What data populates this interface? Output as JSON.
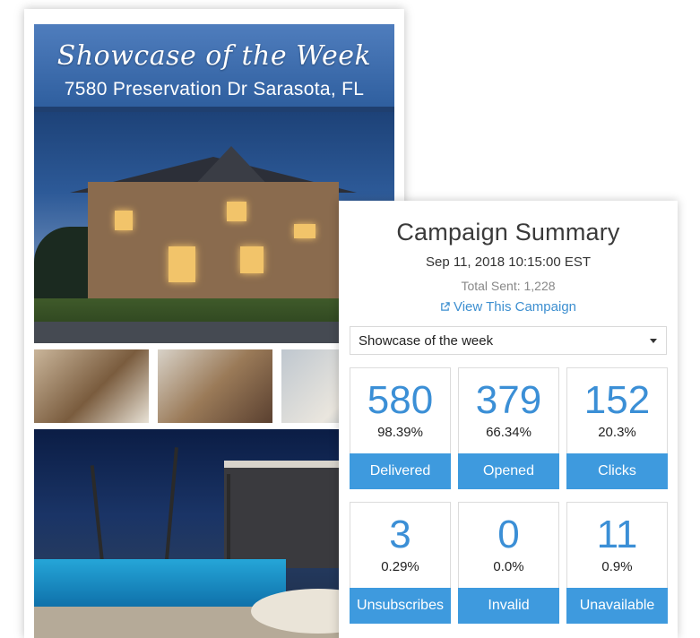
{
  "email": {
    "banner_title": "Showcase of the Week",
    "banner_address": "7580 Preservation Dr Sarasota, FL"
  },
  "summary": {
    "title": "Campaign Summary",
    "date": "Sep 11, 2018 10:15:00 EST",
    "total_sent": "Total Sent: 1,228",
    "view_link": "View This Campaign",
    "selected_campaign": "Showcase of the week"
  },
  "stats": [
    {
      "value": "580",
      "percent": "98.39%",
      "label": "Delivered"
    },
    {
      "value": "379",
      "percent": "66.34%",
      "label": "Opened"
    },
    {
      "value": "152",
      "percent": "20.3%",
      "label": "Clicks"
    },
    {
      "value": "3",
      "percent": "0.29%",
      "label": "Unsubscribes"
    },
    {
      "value": "0",
      "percent": "0.0%",
      "label": "Invalid"
    },
    {
      "value": "11",
      "percent": "0.9%",
      "label": "Unavailable"
    }
  ],
  "colors": {
    "accent": "#3e9ade",
    "stat_number": "#3b8fd6",
    "banner": "#3a6aad",
    "link": "#3d8fd0"
  }
}
